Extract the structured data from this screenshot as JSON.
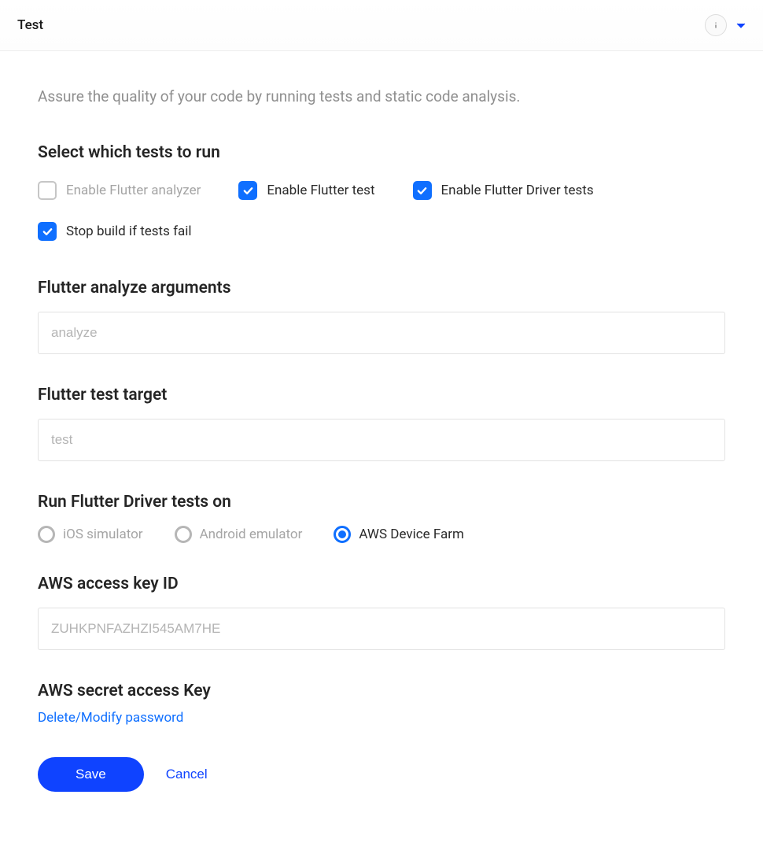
{
  "header": {
    "title": "Test"
  },
  "description": "Assure the quality of your code by running tests and static code analysis.",
  "sections": {
    "select_tests_title": "Select which tests to run",
    "checkboxes": {
      "analyzer": {
        "label": "Enable Flutter analyzer",
        "checked": false
      },
      "test": {
        "label": "Enable Flutter test",
        "checked": true
      },
      "driver": {
        "label": "Enable Flutter Driver tests",
        "checked": true
      },
      "stop_on_fail": {
        "label": "Stop build if tests fail",
        "checked": true
      }
    },
    "analyze_args": {
      "label": "Flutter analyze arguments",
      "placeholder": "analyze",
      "value": ""
    },
    "test_target": {
      "label": "Flutter test target",
      "placeholder": "test",
      "value": ""
    },
    "driver_run_on": {
      "label": "Run Flutter Driver tests on",
      "options": {
        "ios": {
          "label": "iOS simulator",
          "selected": false
        },
        "android": {
          "label": "Android emulator",
          "selected": false
        },
        "aws": {
          "label": "AWS Device Farm",
          "selected": true
        }
      }
    },
    "aws_key_id": {
      "label": "AWS access key ID",
      "placeholder": "ZUHKPNFAZHZI545AM7HE",
      "value": ""
    },
    "aws_secret": {
      "label": "AWS secret access Key",
      "link": "Delete/Modify password"
    }
  },
  "actions": {
    "save": "Save",
    "cancel": "Cancel"
  }
}
